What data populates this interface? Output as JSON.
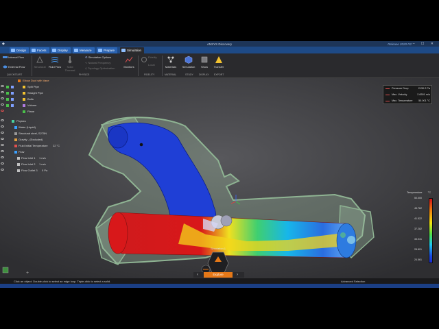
{
  "title_bar": {
    "title": "ANSYS Discovery",
    "release": "Release 2020 R2",
    "window_controls": "– ☐ ✕"
  },
  "tabs": [
    {
      "label": "Design",
      "active": false
    },
    {
      "label": "Facets",
      "active": false
    },
    {
      "label": "Display",
      "active": false
    },
    {
      "label": "Measure",
      "active": false
    },
    {
      "label": "Prepare",
      "active": false
    },
    {
      "label": "Simulation",
      "active": true
    }
  ],
  "ribbon": {
    "quickstart": {
      "items": [
        "Internal Flow",
        "External Flow"
      ],
      "group_label": "Quickstart"
    },
    "physics": {
      "structural": "Structural",
      "fluid_flow": "Fluid Flow",
      "solid_thermal": "Solid Thermal",
      "simulation_options": "Simulation Options",
      "natural_frequency": "Natural Frequency",
      "topology_optimization": "Topology Optimization",
      "monitors": "Monitors",
      "group_label": "Physics"
    },
    "fidelity": {
      "items": [
        "Refine",
        "Fidelity",
        "Local"
      ],
      "group_label": "Fidelity"
    },
    "materials": {
      "label": "Materials",
      "group_label": "Material"
    },
    "simulation": {
      "label": "Simulation",
      "group_label": "Study"
    },
    "show": {
      "label": "Show",
      "group_label": "Display"
    },
    "transfer": {
      "label": "Transfer",
      "group_label": "Export"
    }
  },
  "tree": {
    "root": "Elbow Duct with Vane",
    "bodies": [
      "Split Pipe",
      "Straight Pipe",
      "Bolts",
      "Volume",
      "Plane"
    ],
    "physics_label": "Physics",
    "physics_items": [
      {
        "label": "Water (Liquid)",
        "value": ""
      },
      {
        "label": "Structural steel, S275N",
        "value": ""
      },
      {
        "label": "Gravity - (Excluded)",
        "value": ""
      },
      {
        "label": "Fluid Initial Temperature",
        "value": "22 °C"
      },
      {
        "label": "Flow",
        "value": ""
      },
      {
        "label": "Flow Inlet 1",
        "value": "1 m/s"
      },
      {
        "label": "Flow Inlet 2",
        "value": "1 m/s"
      },
      {
        "label": "Flow Outlet 3",
        "value": "0 Pa"
      }
    ]
  },
  "monitors_panel": [
    {
      "label": "Pressure Drop",
      "value": "2130.2 Pa"
    },
    {
      "label": "Max. Velocity",
      "value": "2.6501 m/s"
    },
    {
      "label": "Max. Temperature",
      "value": "50.001 °C"
    }
  ],
  "legend": {
    "title": "Temperature",
    "unit": "°C",
    "ticks": [
      "50.000",
      "45.762",
      "41.522",
      "37.282",
      "33.041",
      "28.801",
      "24.561"
    ]
  },
  "viewport": {
    "simulation_label": "Simulation 1"
  },
  "explore": {
    "label": "Explore",
    "prev": "‹",
    "next": "›"
  },
  "status_bar": {
    "message": "Click an object. Double-click to select an edge loop. Triple-click to select a solid.",
    "mode": "Advanced Selection"
  },
  "colors": {
    "pipe_blue": "#1f3fd6",
    "pipe_red": "#d0151b",
    "accent_orange": "#e57818",
    "ribbon_blue": "#1e4a86"
  }
}
